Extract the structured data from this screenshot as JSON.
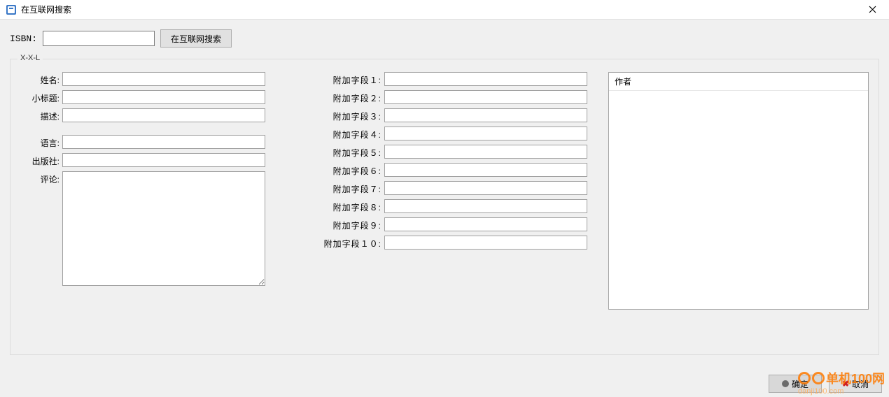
{
  "window": {
    "title": "在互联网搜索"
  },
  "top": {
    "isbn_label": "ISBN:",
    "isbn_value": "",
    "search_button": "在互联网搜索"
  },
  "group": {
    "label": "X-X-L"
  },
  "left_fields": {
    "name": {
      "label": "姓名:",
      "value": ""
    },
    "subtitle": {
      "label": "小标题:",
      "value": ""
    },
    "description": {
      "label": "描述:",
      "value": ""
    },
    "language": {
      "label": "语言:",
      "value": ""
    },
    "publisher": {
      "label": "出版社:",
      "value": ""
    },
    "comment": {
      "label": "评论:",
      "value": ""
    }
  },
  "mid_fields": [
    {
      "label": "附加字段１:",
      "value": ""
    },
    {
      "label": "附加字段２:",
      "value": ""
    },
    {
      "label": "附加字段３:",
      "value": ""
    },
    {
      "label": "附加字段４:",
      "value": ""
    },
    {
      "label": "附加字段５:",
      "value": ""
    },
    {
      "label": "附加字段６:",
      "value": ""
    },
    {
      "label": "附加字段７:",
      "value": ""
    },
    {
      "label": "附加字段８:",
      "value": ""
    },
    {
      "label": "附加字段９:",
      "value": ""
    },
    {
      "label": "附加字段１０:",
      "value": ""
    }
  ],
  "right": {
    "list_header": "作者"
  },
  "footer": {
    "ok": "确定",
    "cancel": "取消"
  },
  "watermark": {
    "brand": "单机100网",
    "url": "danji100.com"
  }
}
